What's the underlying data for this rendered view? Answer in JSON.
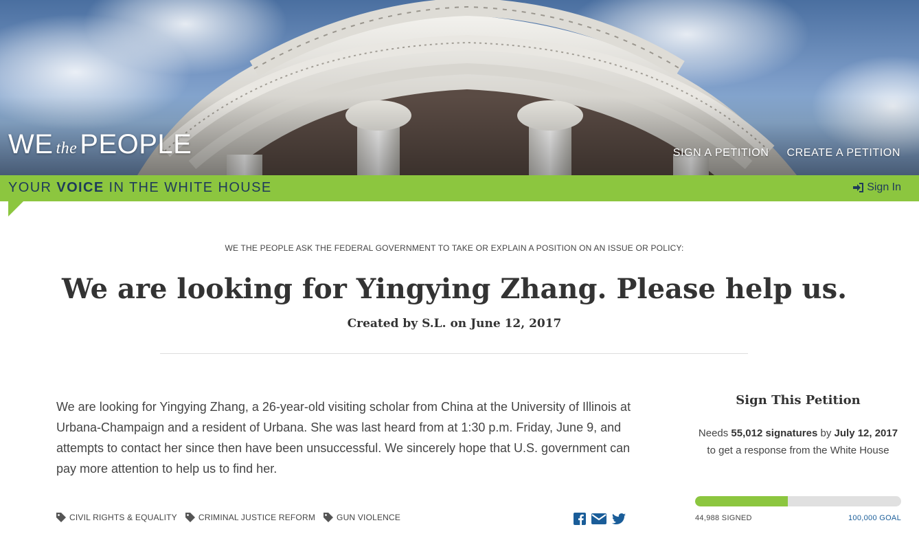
{
  "header": {
    "logo_we": "WE",
    "logo_the": "the",
    "logo_people": "PEOPLE",
    "nav": {
      "sign": "SIGN A PETITION",
      "create": "CREATE A PETITION"
    }
  },
  "banner": {
    "tagline_pre": "YOUR ",
    "tagline_bold": "VOICE",
    "tagline_post": " IN THE WHITE HOUSE",
    "signin": "Sign In",
    "color": "#8cc63f"
  },
  "petition": {
    "kicker": "WE THE PEOPLE ASK THE FEDERAL GOVERNMENT TO TAKE OR EXPLAIN A POSITION ON AN ISSUE OR POLICY:",
    "title": "We are looking for Yingying Zhang. Please help us.",
    "created": "Created by S.L. on June 12, 2017",
    "body": "We are looking for Yingying Zhang, a 26-year-old visiting scholar from China at the University of Illinois at Urbana-Champaign and a resident of Urbana. She was last heard from at 1:30 p.m. Friday, June 9, and attempts to contact her since then have been unsuccessful. We sincerely hope that U.S. government can pay more attention to help us to find her.",
    "tags": [
      "CIVIL RIGHTS & EQUALITY",
      "CRIMINAL JUSTICE REFORM",
      "GUN VIOLENCE"
    ],
    "share_icons": [
      "facebook-icon",
      "email-icon",
      "twitter-icon"
    ]
  },
  "sidebar": {
    "title": "Sign This Petition",
    "needs_pre": "Needs ",
    "needs_count": "55,012 signatures",
    "needs_mid": " by ",
    "needs_date": "July 12, 2017",
    "needs_post": " to get a response from the White House",
    "signed": "44,988 SIGNED",
    "goal": "100,000 GOAL",
    "progress": 0.44988
  }
}
